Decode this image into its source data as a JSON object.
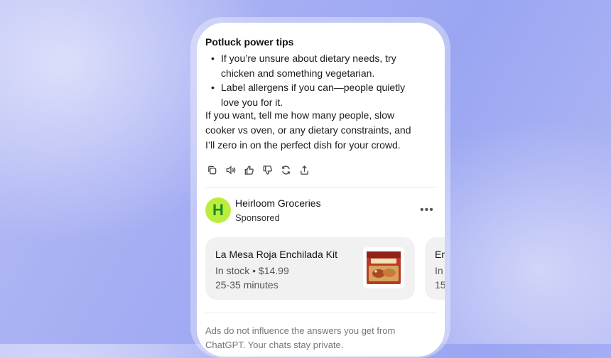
{
  "section": {
    "heading": "Potluck power tips",
    "bullets": [
      {
        "line1": "If you’re unsure about dietary needs, try",
        "line2": "chicken and something vegetarian."
      },
      {
        "line1": "Label allergens if you can—people quietly",
        "line2": "love you for it."
      }
    ],
    "paragraph": {
      "line1": "If you want, tell me how many people, slow",
      "line2": "cooker vs oven, or any dietary constraints, and",
      "line3": "I’ll zero in on the perfect dish for your crowd."
    }
  },
  "actions": [
    "copy-icon",
    "speaker-icon",
    "thumbs-up-icon",
    "thumbs-down-icon",
    "regenerate-icon",
    "share-icon"
  ],
  "ad": {
    "logo_letter": "H",
    "brand": "Heirloom Groceries",
    "sponsored": "Sponsored",
    "more": "•••",
    "cards": [
      {
        "title": "La Mesa Roja Enchilada Kit",
        "stock": "In stock • $14.99",
        "time": "25-35 minutes"
      },
      {
        "title": "En",
        "stock": "In",
        "time": "15"
      }
    ]
  },
  "disclaimer": {
    "line1": "Ads do not influence the answers you get from",
    "line2": "ChatGPT. Your chats stay private."
  },
  "colors": {
    "logo_bg": "#b9ef3a",
    "logo_fg": "#1d8a2a",
    "card_bg": "#f1f1f1"
  }
}
